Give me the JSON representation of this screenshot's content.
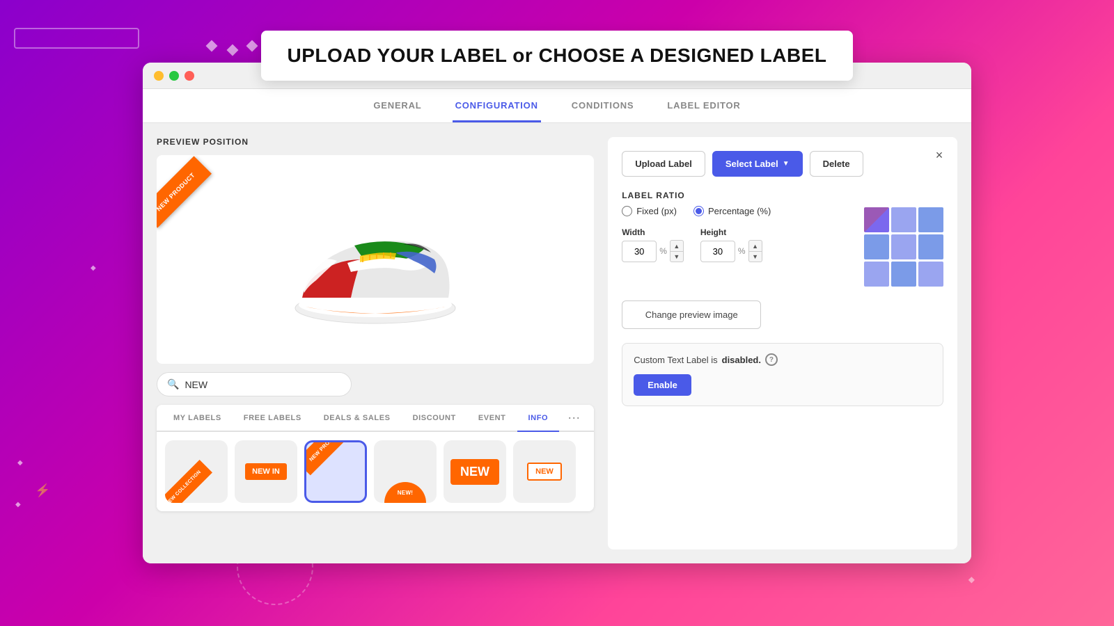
{
  "header": {
    "title": "UPLOAD YOUR LABEL or CHOOSE A DESIGNED LABEL"
  },
  "window": {
    "traffic_lights": [
      "yellow",
      "green",
      "red"
    ]
  },
  "tabs": [
    {
      "id": "general",
      "label": "GENERAL",
      "active": false
    },
    {
      "id": "configuration",
      "label": "CONFIGURATION",
      "active": true
    },
    {
      "id": "conditions",
      "label": "CONDITIONS",
      "active": false
    },
    {
      "id": "label_editor",
      "label": "LABEL EDITOR",
      "active": false
    }
  ],
  "preview": {
    "section_label": "PREVIEW POSITION",
    "ribbon_text": "NEW PRODUCT",
    "sneaker_emoji": "👟"
  },
  "search": {
    "placeholder": "NEW",
    "value": "NEW",
    "icon": "🔍"
  },
  "label_categories": [
    {
      "id": "my_labels",
      "label": "MY LABELS",
      "active": false
    },
    {
      "id": "free_labels",
      "label": "FREE LABELS",
      "active": false
    },
    {
      "id": "deals_sales",
      "label": "DEALS & SALES",
      "active": false
    },
    {
      "id": "discount",
      "label": "DISCOUNT",
      "active": false
    },
    {
      "id": "event",
      "label": "EVENT",
      "active": false
    },
    {
      "id": "info",
      "label": "INFO",
      "active": true
    }
  ],
  "label_items": [
    {
      "id": "new_collection",
      "text": "NEW COLLECTION",
      "type": "corner_ribbon",
      "selected": false
    },
    {
      "id": "new_in",
      "text": "NEW IN",
      "type": "center_badge",
      "selected": false
    },
    {
      "id": "new_product",
      "text": "NEW PRODUCT",
      "type": "corner_ribbon_selected",
      "selected": true
    },
    {
      "id": "new_half",
      "text": "NEW!",
      "type": "half_circle",
      "selected": false
    },
    {
      "id": "new_plain",
      "text": "NEW",
      "type": "center_plain",
      "selected": false
    },
    {
      "id": "new_outline",
      "text": "NEW",
      "type": "center_outline",
      "selected": false
    }
  ],
  "config": {
    "buttons": {
      "upload_label": "Upload Label",
      "select_label": "Select Label",
      "delete": "Delete"
    },
    "label_ratio": {
      "section_title": "LABEL RATIO",
      "options": [
        {
          "id": "fixed_px",
          "label": "Fixed (px)",
          "checked": false
        },
        {
          "id": "percentage",
          "label": "Percentage (%)",
          "checked": true
        }
      ]
    },
    "width": {
      "label": "Width",
      "value": "30",
      "unit": "%"
    },
    "height": {
      "label": "Height",
      "value": "30",
      "unit": "%"
    },
    "change_preview_btn": "Change preview image",
    "custom_text": {
      "label_prefix": "Custom Text Label is",
      "status": "disabled.",
      "info_char": "?",
      "enable_btn": "Enable"
    },
    "close_icon": "×"
  }
}
